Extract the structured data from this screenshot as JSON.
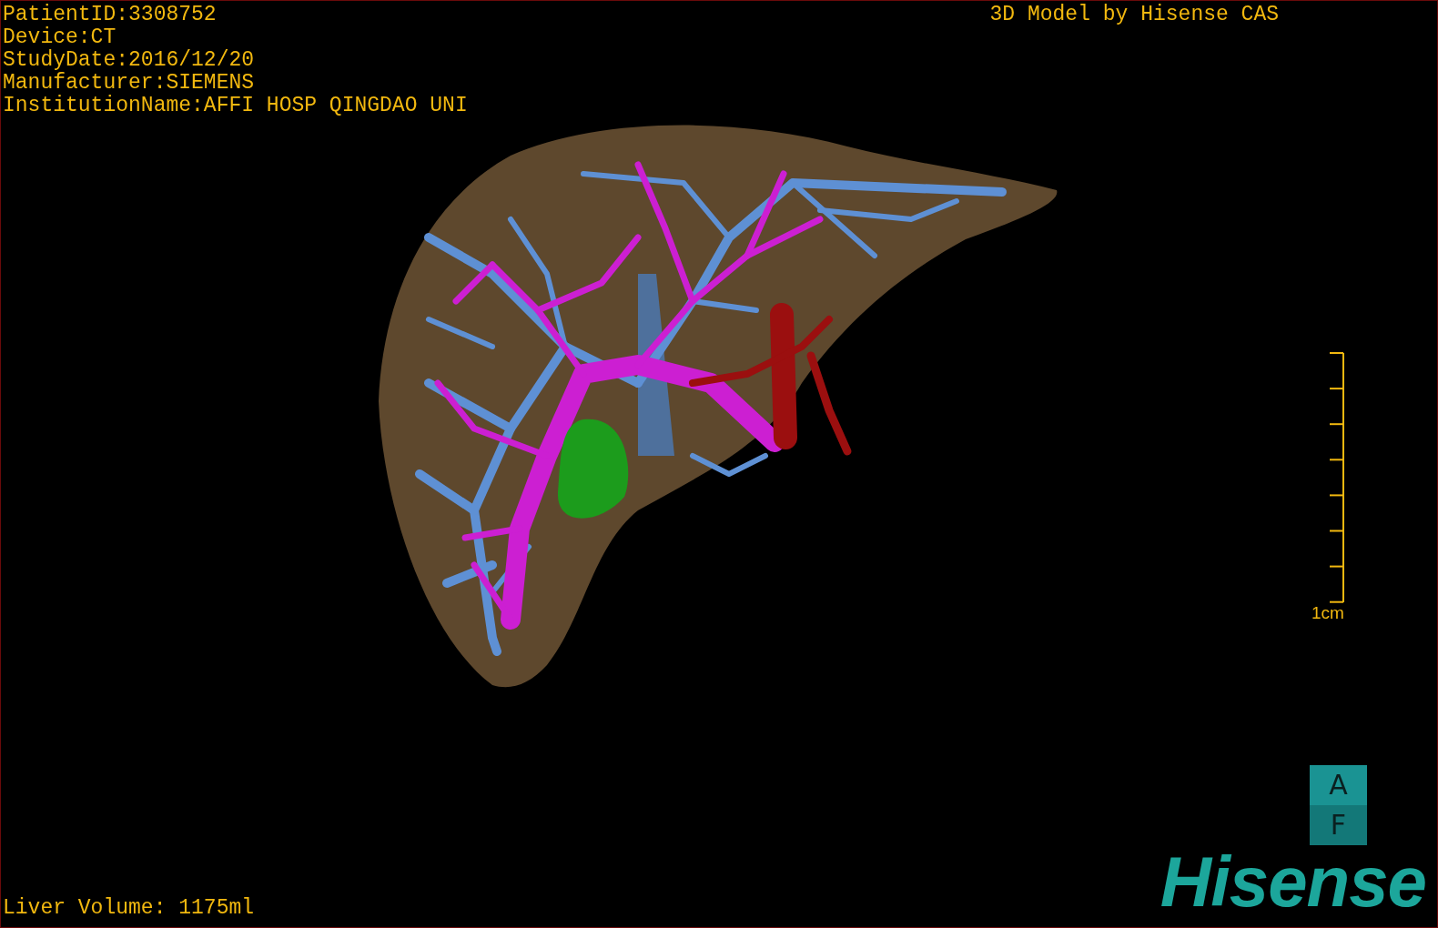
{
  "patient_info": [
    "PatientID:3308752",
    "Device:CT",
    "StudyDate:2016/12/20",
    "Manufacturer:SIEMENS",
    "InstitutionName:AFFI HOSP QINGDAO UNI"
  ],
  "title": "3D Model by Hisense CAS",
  "scale_bar": {
    "label": "1cm"
  },
  "orientation": {
    "top": "A",
    "bottom": "F"
  },
  "logo": "Hisense",
  "liver_volume": "Liver Volume: 1175ml"
}
